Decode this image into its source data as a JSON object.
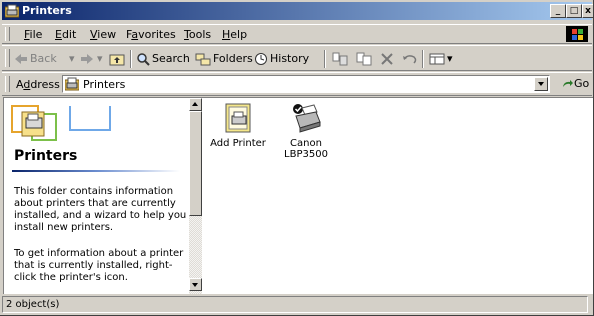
{
  "window": {
    "title": "Printers"
  },
  "menu": {
    "items": [
      {
        "key": "F",
        "rest": "ile"
      },
      {
        "key": "E",
        "rest": "dit"
      },
      {
        "key": "V",
        "rest": "iew"
      },
      {
        "pre": "F",
        "key": "a",
        "rest": "vorites"
      },
      {
        "key": "T",
        "rest": "ools"
      },
      {
        "key": "H",
        "rest": "elp"
      }
    ]
  },
  "toolbar": {
    "back_label": "Back",
    "search_label": "Search",
    "folders_label": "Folders",
    "history_label": "History",
    "icons": [
      "back-arrow-icon",
      "forward-arrow-icon",
      "up-folder-icon",
      "search-icon",
      "folders-icon",
      "history-icon",
      "move-to-icon",
      "copy-to-icon",
      "delete-icon",
      "undo-icon",
      "views-icon"
    ]
  },
  "address": {
    "label_pre": "A",
    "label_key": "d",
    "label_rest": "dress",
    "value": "Printers",
    "go_label": "Go"
  },
  "info_pane": {
    "title": "Printers",
    "para1": "This folder contains information about printers that are currently installed, and a wizard to help you install new printers.",
    "para2": "To get information about a printer that is currently installed, right-click the printer's icon."
  },
  "files": [
    {
      "label": "Add Printer",
      "icon": "add-printer-icon"
    },
    {
      "label_line1": "Canon",
      "label_line2": "LBP3500",
      "icon": "printer-icon"
    }
  ],
  "status": {
    "text": "2 object(s)"
  },
  "colors": {
    "title_start": "#0a246a",
    "title_end": "#a6caf0",
    "face": "#d4d0c8"
  }
}
